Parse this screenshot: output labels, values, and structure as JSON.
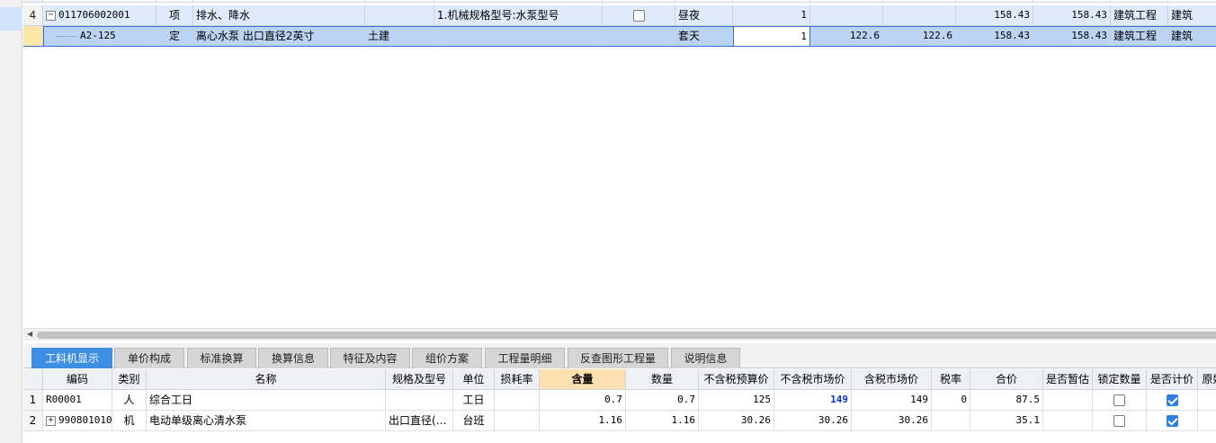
{
  "upper_table": {
    "row4": {
      "rownum": "4",
      "code": "011706002001",
      "type": "项",
      "name": "排水、降水",
      "spec": "",
      "feature": "1.机械规格型号:水泵型号",
      "unit": "昼夜",
      "qty": "1",
      "c11": "",
      "c12": "",
      "price1": "158.43",
      "price2": "158.43",
      "discipline": "建筑工程",
      "extra": "建筑"
    },
    "row5": {
      "code": "A2-125",
      "type": "定",
      "name": "离心水泵 出口直径2英寸",
      "spec": "土建",
      "unit": "套天",
      "qty": "1",
      "c11": "122.6",
      "c12": "122.6",
      "price1": "158.43",
      "price2": "158.43",
      "discipline": "建筑工程",
      "extra": "建筑"
    }
  },
  "tabs": [
    {
      "label": "工料机显示",
      "active": true
    },
    {
      "label": "单价构成"
    },
    {
      "label": "标准换算"
    },
    {
      "label": "换算信息"
    },
    {
      "label": "特征及内容"
    },
    {
      "label": "组价方案"
    },
    {
      "label": "工程量明细"
    },
    {
      "label": "反查图形工程量"
    },
    {
      "label": "说明信息"
    }
  ],
  "lower_table": {
    "headers": {
      "code": "编码",
      "category": "类别",
      "name": "名称",
      "spec": "规格及型号",
      "unit": "单位",
      "loss": "损耗率",
      "content": "含量",
      "quantity": "数量",
      "budget_ex_tax": "不含税预算价",
      "market_ex_tax": "不含税市场价",
      "market_inc_tax": "含税市场价",
      "tax_rate": "税率",
      "total": "合价",
      "provisional": "是否暂估",
      "lock_qty": "锁定数量",
      "count_price": "是否计价",
      "orig": "原始"
    },
    "rows": [
      {
        "rownum": "1",
        "code": "R00001",
        "category": "人",
        "name": "综合工日",
        "spec": "",
        "unit": "工日",
        "loss": "",
        "content": "0.7",
        "quantity": "0.7",
        "budget_ex_tax": "125",
        "market_ex_tax": "149",
        "market_inc_tax": "149",
        "tax_rate": "0",
        "total": "87.5",
        "lock_checked": false,
        "count_checked": true
      },
      {
        "rownum": "2",
        "code": "990801010",
        "category": "机",
        "name": "电动单级离心清水泵",
        "spec": "出口直径(…",
        "unit": "台班",
        "loss": "",
        "content": "1.16",
        "quantity": "1.16",
        "budget_ex_tax": "30.26",
        "market_ex_tax": "30.26",
        "market_inc_tax": "30.26",
        "tax_rate": "",
        "total": "35.1",
        "lock_checked": false,
        "count_checked": true
      }
    ]
  }
}
